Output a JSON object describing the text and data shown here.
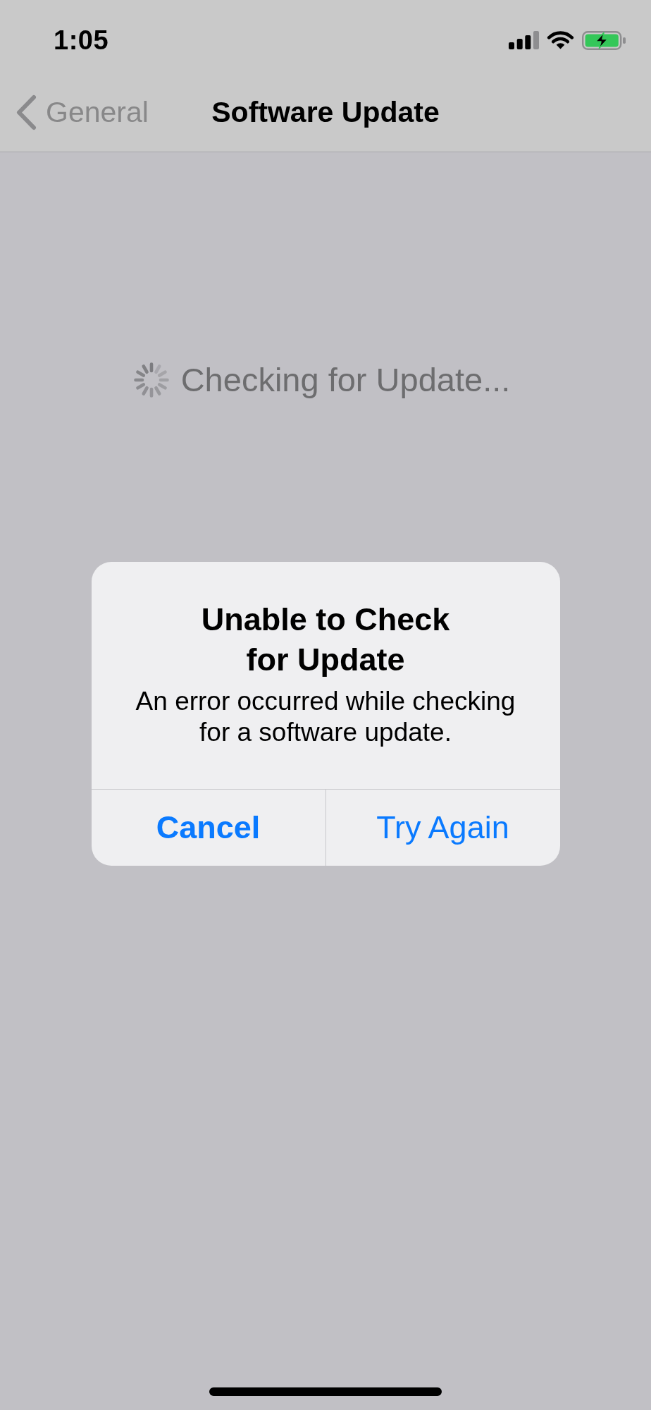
{
  "status_bar": {
    "time": "1:05"
  },
  "nav_bar": {
    "back_label": "General",
    "title": "Software Update"
  },
  "content": {
    "status_text": "Checking for Update..."
  },
  "alert": {
    "title": "Unable to Check for Update",
    "message": "An error occurred while checking for a software update.",
    "buttons": [
      {
        "label": "Cancel",
        "kind": "preferred"
      },
      {
        "label": "Try Again",
        "kind": "default"
      }
    ]
  }
}
